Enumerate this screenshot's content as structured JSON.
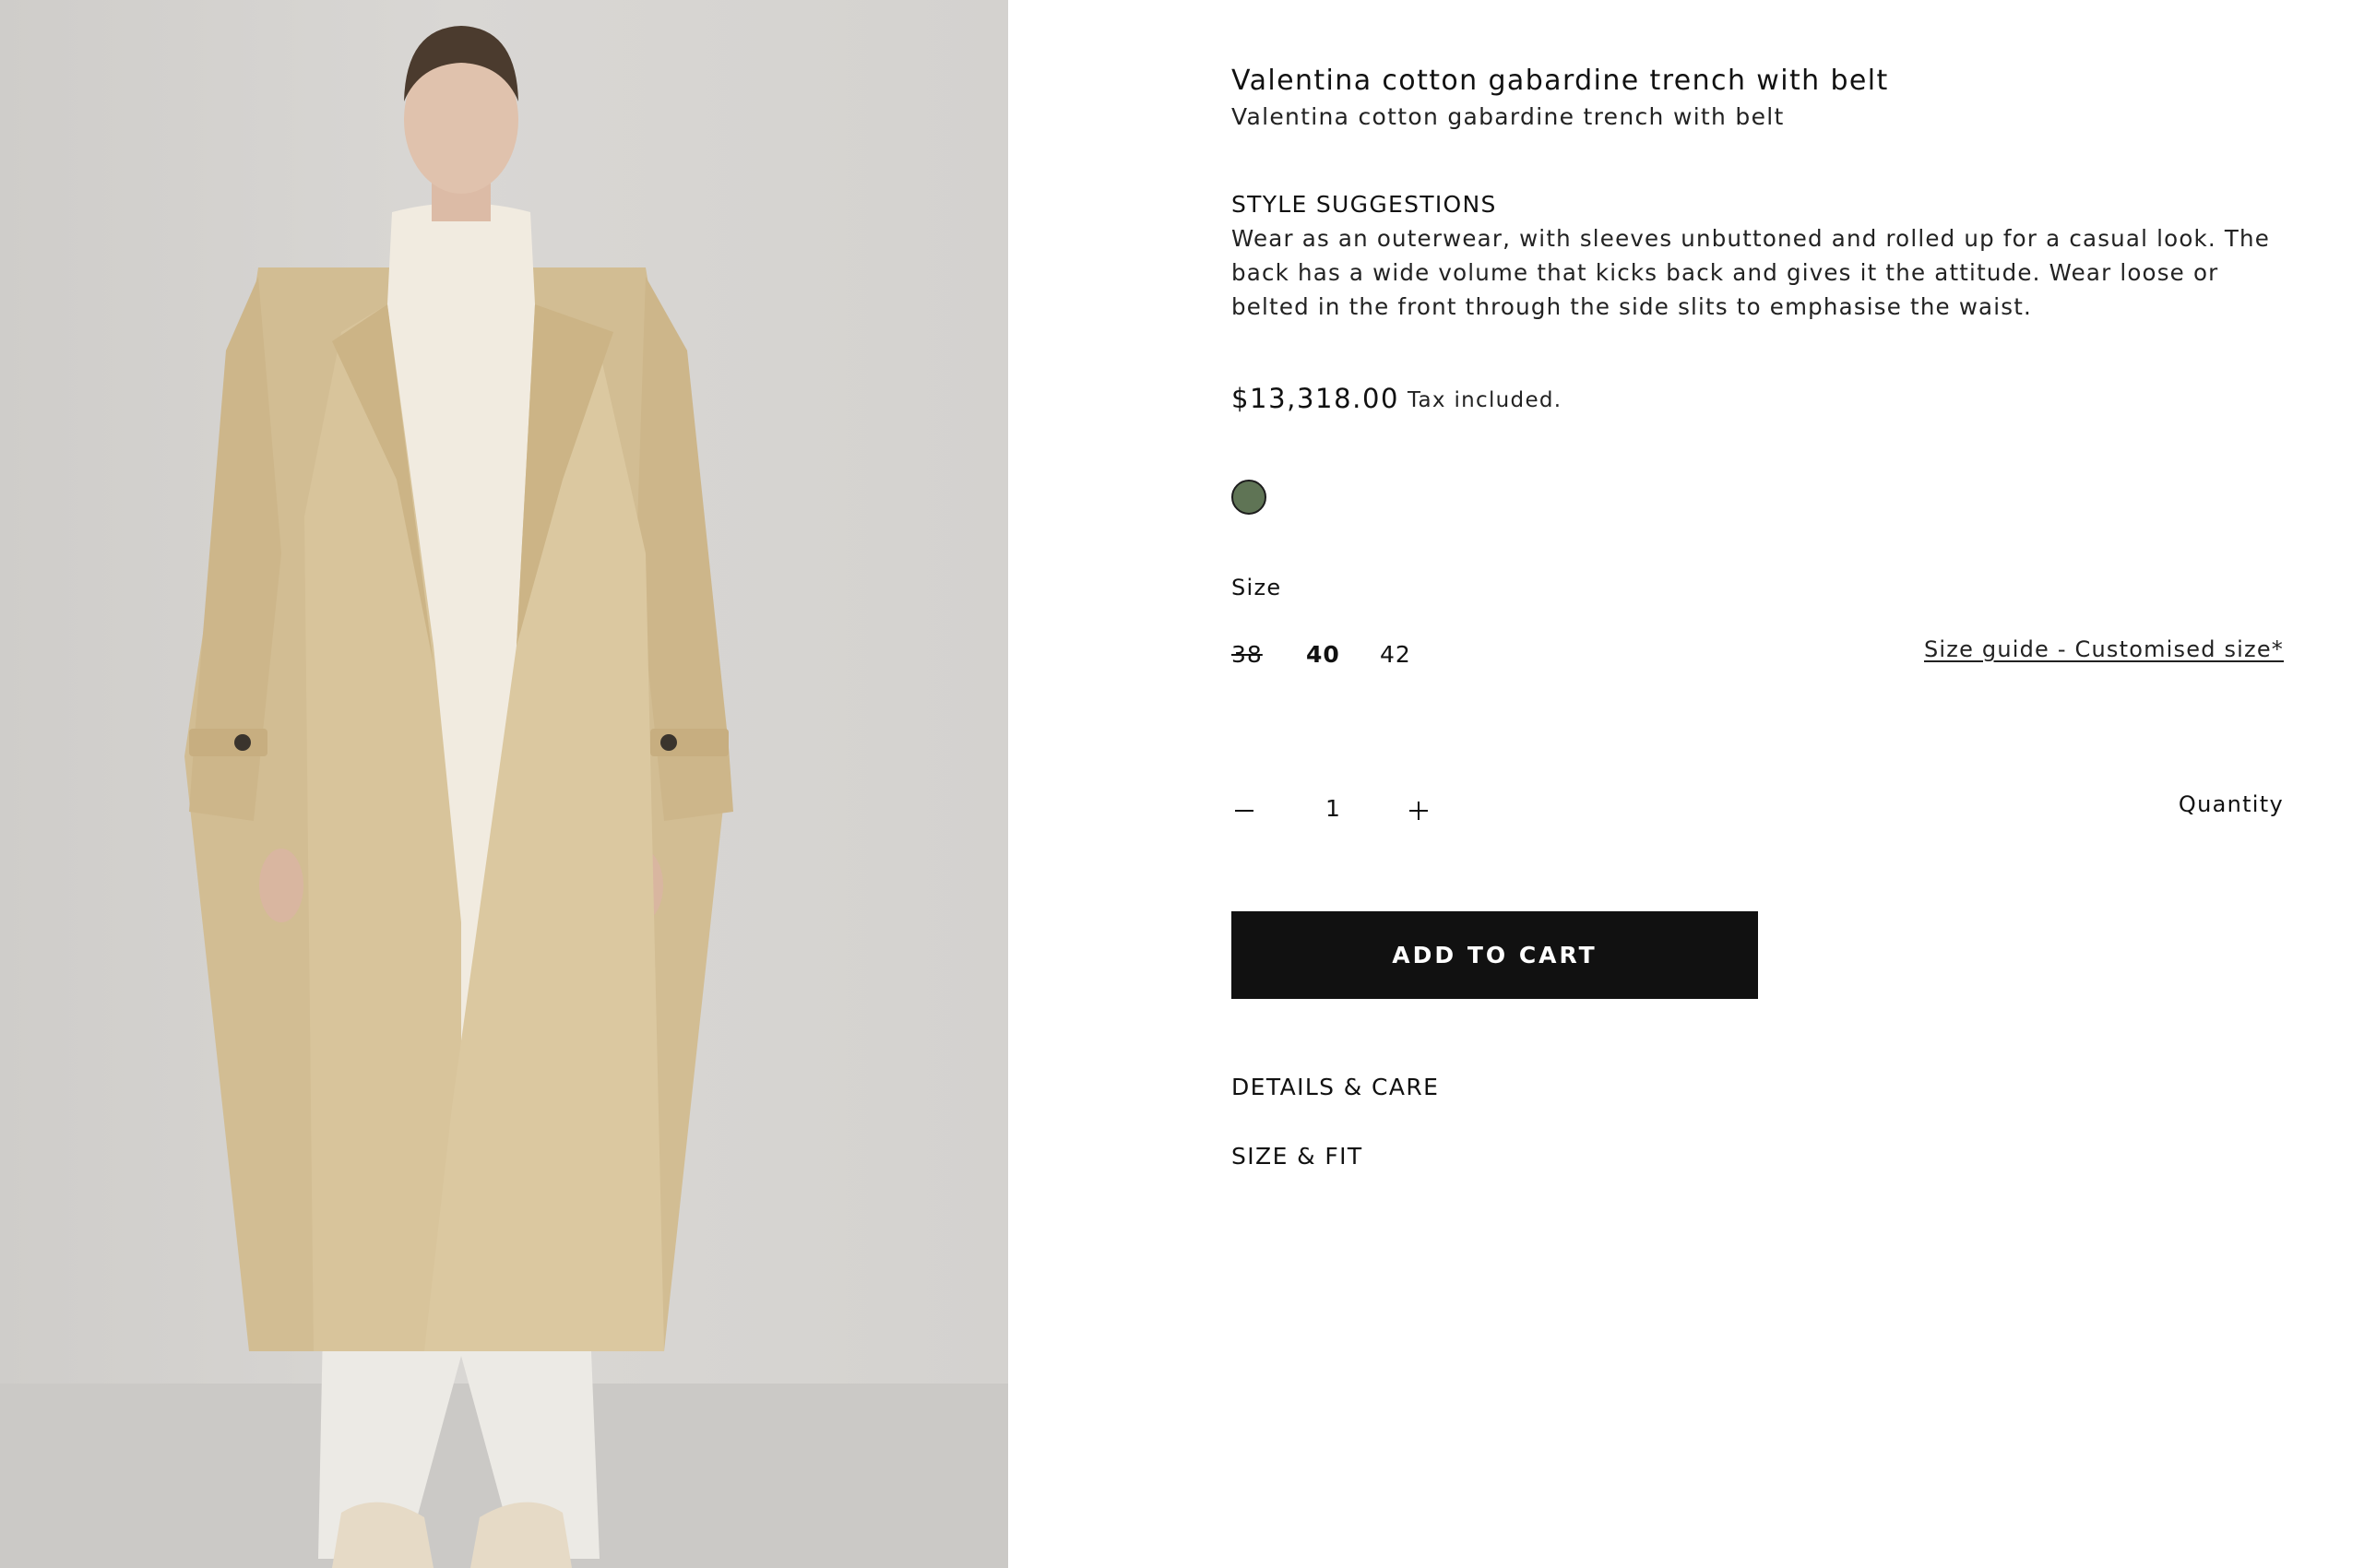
{
  "product": {
    "title": "Valentina cotton gabardine trench with belt",
    "subtitle": "Valentina cotton gabardine trench with belt",
    "image_alt": "Model wearing beige cotton gabardine trench coat"
  },
  "style_suggestions": {
    "heading": "STYLE SUGGESTIONS",
    "body": "Wear as an outerwear, with sleeves unbuttoned and rolled up for a casual look. The back has a wide volume that kicks back and gives it the attitude. Wear loose or belted in the front through the side slits to emphasise the waist."
  },
  "pricing": {
    "price": "$13,318.00",
    "tax_note": "Tax included."
  },
  "colors": {
    "swatches": [
      {
        "name": "green-swatch",
        "hex": "#5f7455",
        "selected": true
      }
    ]
  },
  "size": {
    "label": "Size",
    "options": [
      {
        "value": "38",
        "available": false
      },
      {
        "value": "40",
        "selected": true
      },
      {
        "value": "42"
      }
    ],
    "guide_link": "Size guide - Customised size*"
  },
  "quantity": {
    "label": "Quantity",
    "value": "1"
  },
  "cart": {
    "add_label": "ADD TO CART"
  },
  "accordions": {
    "details": "DETAILS & CARE",
    "size_fit": "SIZE & FIT"
  }
}
